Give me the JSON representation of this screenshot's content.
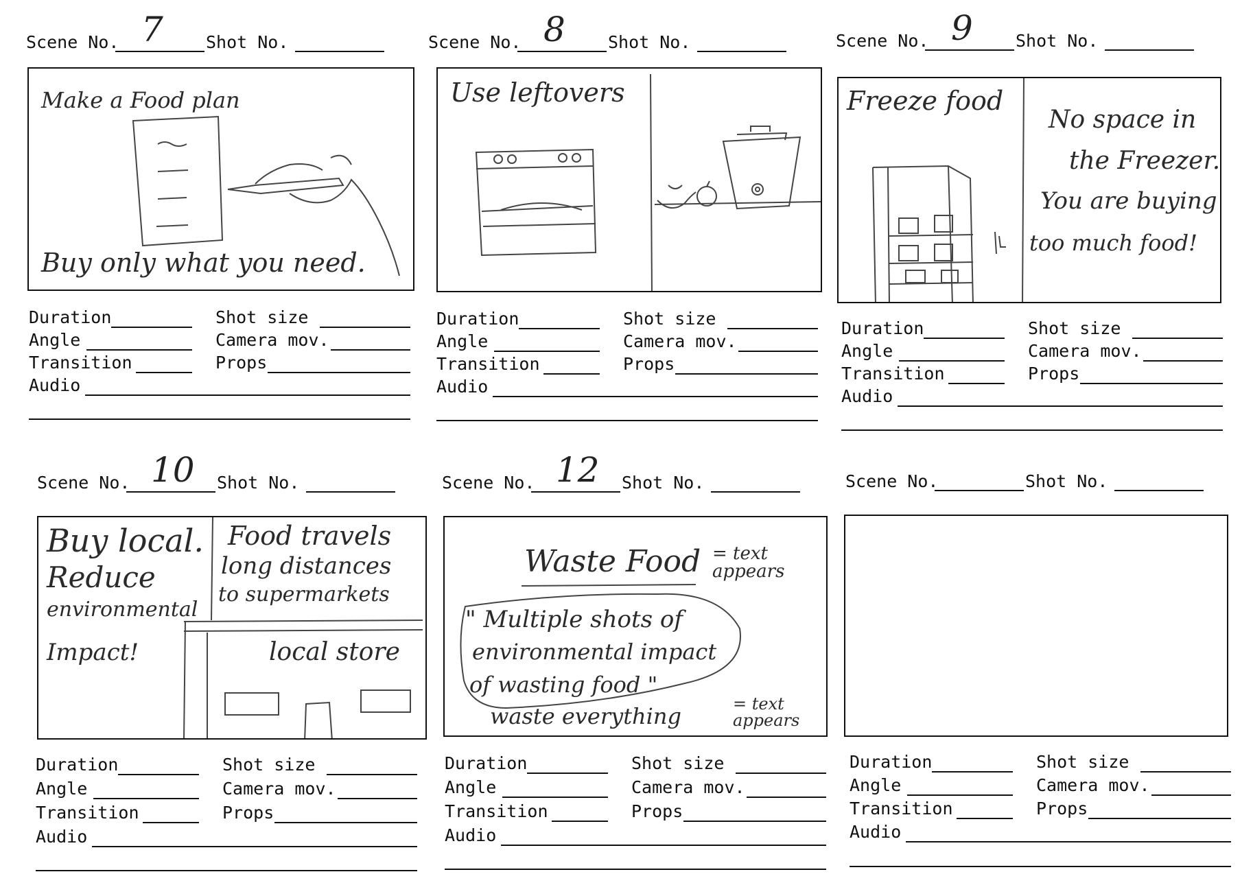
{
  "form": {
    "scene_label": "Scene No.",
    "shot_label": "Shot No.",
    "duration_label": "Duration",
    "shot_size_label": "Shot size",
    "angle_label": "Angle",
    "camera_label": "Camera mov.",
    "transition_label": "Transition",
    "props_label": "Props",
    "audio_label": "Audio"
  },
  "cells": [
    {
      "scene": "7",
      "shot": "",
      "notes": {
        "title": "Make a Food plan",
        "caption": "Buy only what you need."
      }
    },
    {
      "scene": "8",
      "shot": "",
      "notes": {
        "title": "Use leftovers"
      }
    },
    {
      "scene": "9",
      "shot": "",
      "notes": {
        "title": "Freeze food",
        "side_line1": "No space in",
        "side_line2": "the Freezer.",
        "side_line3": "You are buying",
        "side_line4": "too much food!"
      }
    },
    {
      "scene": "10",
      "shot": "",
      "notes": {
        "left_line1": "Buy local.",
        "left_line2": "Reduce",
        "left_line3": "environmental",
        "left_line4": "Impact!",
        "right_line1": "Food travels",
        "right_line2": "long distances",
        "right_line3": "to supermarkets",
        "store": "local store"
      }
    },
    {
      "scene": "12",
      "shot": "",
      "notes": {
        "title": "Waste Food",
        "title_note": "= text appears",
        "bubble_line1": "\" Multiple shots of",
        "bubble_line2": "environmental impact",
        "bubble_line3": "of wasting food \"",
        "bottom": "waste everything",
        "bottom_note": "= text appears"
      }
    },
    {
      "scene": "",
      "shot": "",
      "notes": {}
    }
  ]
}
